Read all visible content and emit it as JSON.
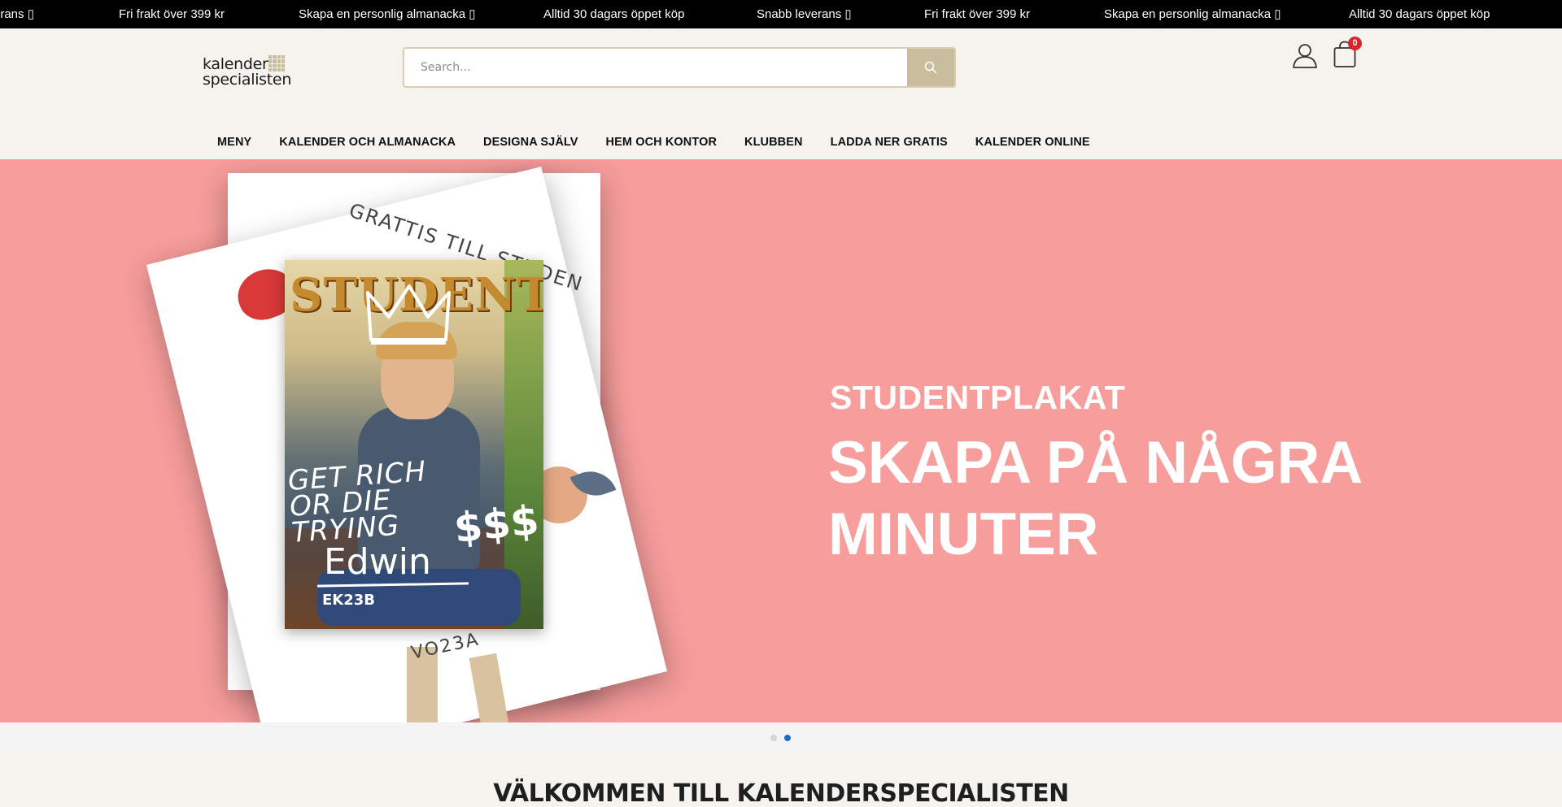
{
  "announcement": {
    "messages": [
      "erans ▯",
      "Fri frakt över 399 kr",
      "Skapa en personlig almanacka ▯",
      "Alltid 30 dagars öppet köp",
      "Snabb leverans ▯",
      "Fri frakt över 399 kr",
      "Skapa en personlig almanacka ▯",
      "Alltid 30 dagars öppet köp"
    ]
  },
  "header": {
    "logo": {
      "line1": "kalender",
      "line2": "specialisten",
      "accent_color": "#c9bc9c"
    },
    "search": {
      "placeholder": "Search...",
      "value": "",
      "button_icon": "search-icon"
    },
    "account_icon": "user-icon",
    "cart": {
      "icon": "shopping-bag-icon",
      "count": "0",
      "badge_color": "#d6262b"
    }
  },
  "nav": {
    "items": [
      "MENY",
      "KALENDER OCH ALMANACKA",
      "DESIGNA SJÄLV",
      "HEM OCH KONTOR",
      "KLUBBEN",
      "LADDA NER GRATIS",
      "KALENDER ONLINE"
    ]
  },
  "hero": {
    "background_color": "#f79d9c",
    "kicker": "STUDENTPLAKAT",
    "headline": "SKAPA PÅ NÅGRA MINUTER",
    "image": {
      "ring_text_top": "GRATTIS TILL STUDEN",
      "ring_text_bottom": "VO23A",
      "poster_title": "STUDENT",
      "poster_slogan": [
        "GET RICH",
        "OR DIE",
        "TRYING"
      ],
      "poster_dollars": "$$$",
      "poster_name": "Edwin",
      "poster_code": "EK23B"
    }
  },
  "slider": {
    "active_index": 1,
    "dot_count": 2,
    "active_color": "#1a6fc4",
    "inactive_color": "#d6d6d6"
  },
  "welcome": {
    "title": "VÄLKOMMEN TILL KALENDERSPECIALISTEN"
  }
}
